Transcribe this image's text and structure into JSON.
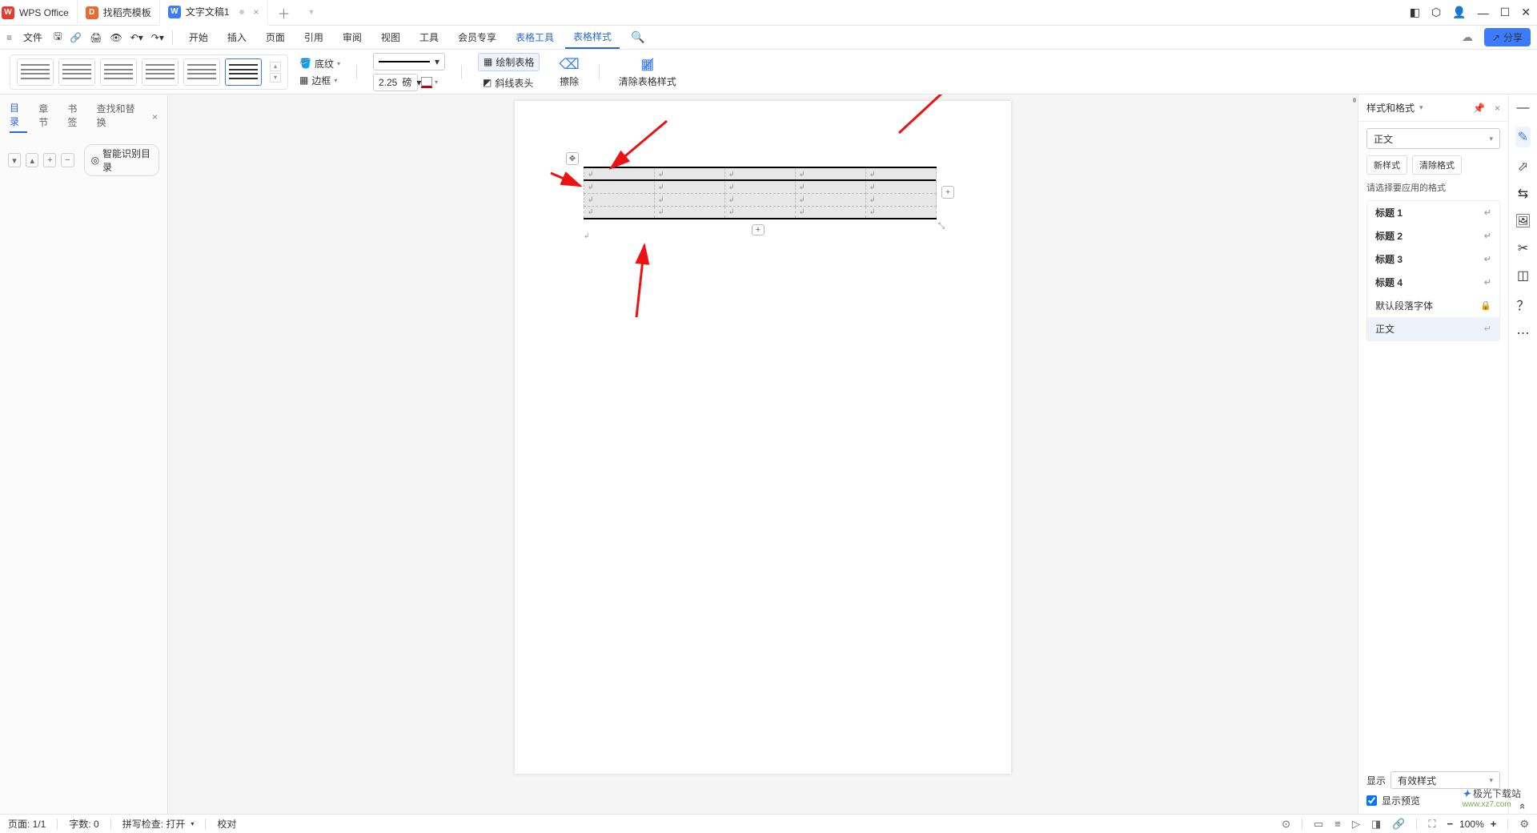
{
  "titlebar": {
    "app_name": "WPS Office",
    "tabs": [
      {
        "label": "找稻壳模板"
      },
      {
        "label": "文字文稿1"
      }
    ]
  },
  "menubar": {
    "file": "文件",
    "items": [
      "开始",
      "插入",
      "页面",
      "引用",
      "审阅",
      "视图",
      "工具",
      "会员专享",
      "表格工具",
      "表格样式"
    ]
  },
  "share_label": "分享",
  "ribbon": {
    "shading": "底纹",
    "border": "边框",
    "line_weight": "2.25",
    "line_unit": "磅",
    "draw_table": "绘制表格",
    "diag_header": "斜线表头",
    "erase": "擦除",
    "clear_style": "清除表格样式"
  },
  "left_panel": {
    "tabs": [
      "目录",
      "章节",
      "书签",
      "查找和替换"
    ],
    "smart_toc": "智能识别目录"
  },
  "right_panel": {
    "title": "样式和格式",
    "current": "正文",
    "new_style": "新样式",
    "clear_fmt": "清除格式",
    "prompt": "请选择要应用的格式",
    "styles": {
      "h1": "标题 1",
      "h2": "标题 2",
      "h3": "标题 3",
      "h4": "标题 4",
      "default_para": "默认段落字体",
      "body": "正文"
    },
    "show": "显示",
    "show_opt": "有效样式",
    "preview": "显示预览"
  },
  "statusbar": {
    "page": "页面: 1/1",
    "words": "字数: 0",
    "spell": "拼写检查: 打开",
    "proof": "校对",
    "zoom": "100%"
  },
  "watermark": {
    "a": "极光下载站",
    "b": "www.xz7.com"
  }
}
